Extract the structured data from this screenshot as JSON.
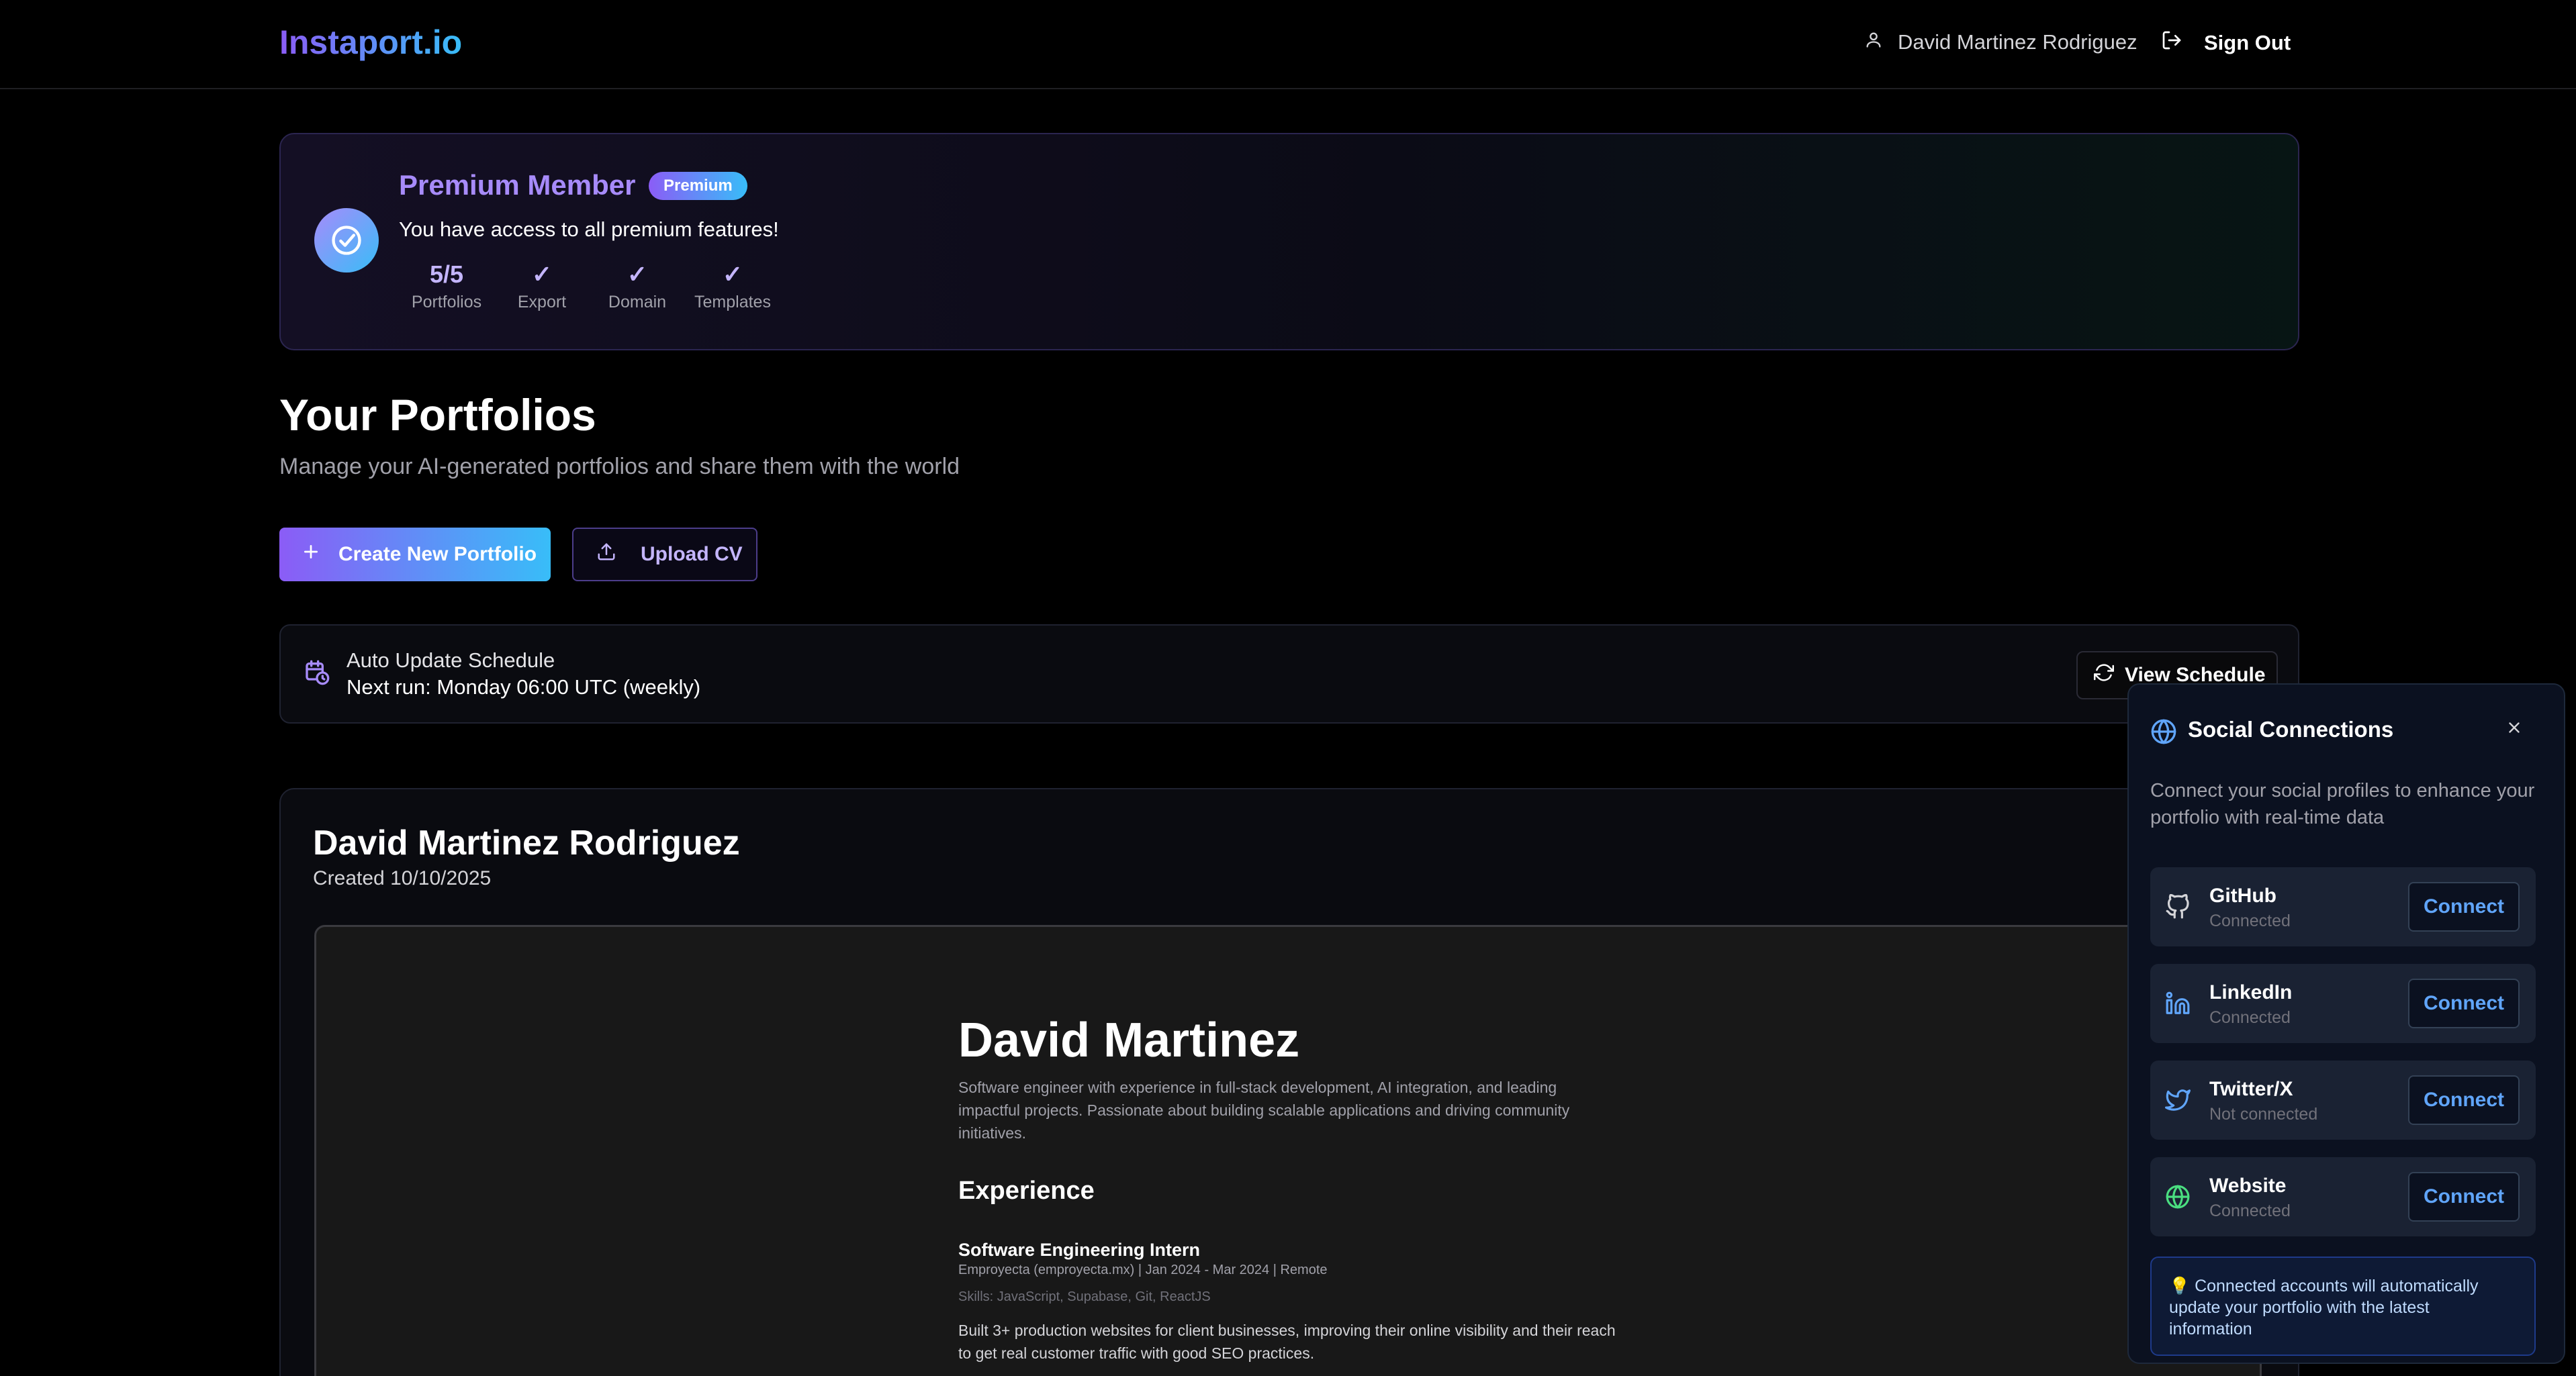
{
  "header": {
    "logo": "Instaport.io",
    "user_name": "David Martinez Rodriguez",
    "sign_out": "Sign Out"
  },
  "premium": {
    "title": "Premium Member",
    "badge": "Premium",
    "subtitle": "You have access to all premium features!",
    "stats": [
      {
        "value": "5/5",
        "label": "Portfolios"
      },
      {
        "value": "✓",
        "label": "Export"
      },
      {
        "value": "✓",
        "label": "Domain"
      },
      {
        "value": "✓",
        "label": "Templates"
      }
    ]
  },
  "portfolios": {
    "title": "Your Portfolios",
    "subtitle": "Manage your AI-generated portfolios and share them with the world",
    "create_label": "Create New Portfolio",
    "upload_label": "Upload CV"
  },
  "schedule": {
    "title": "Auto Update Schedule",
    "next_run": "Next run: Monday 06:00 UTC (weekly)",
    "view_label": "View Schedule"
  },
  "portfolio_card": {
    "name": "David Martinez Rodriguez",
    "created": "Created 10/10/2025",
    "preview": {
      "name": "David Martinez",
      "bio": "Software engineer with experience in full-stack development, AI integration, and leading impactful projects. Passionate about building scalable applications and driving community initiatives.",
      "section": "Experience",
      "role": "Software Engineering Intern",
      "company_line": "Emproyecta (emproyecta.mx) | Jan 2024 - Mar 2024 | Remote",
      "skills": "Skills: JavaScript, Supabase, Git, ReactJS",
      "description": "Built 3+ production websites for client businesses, improving their online visibility and their reach to get real customer traffic with good SEO practices."
    }
  },
  "social": {
    "title": "Social Connections",
    "description": "Connect your social profiles to enhance your portfolio with real-time data",
    "items": [
      {
        "name": "GitHub",
        "status": "Connected",
        "button": "Connect",
        "icon": "github-icon",
        "color": "#d4d4d8"
      },
      {
        "name": "LinkedIn",
        "status": "Connected",
        "button": "Connect",
        "icon": "linkedin-icon",
        "color": "#60a5fa"
      },
      {
        "name": "Twitter/X",
        "status": "Not connected",
        "button": "Connect",
        "icon": "twitter-icon",
        "color": "#60a5fa"
      },
      {
        "name": "Website",
        "status": "Connected",
        "button": "Connect",
        "icon": "globe-icon",
        "color": "#4ade80"
      }
    ],
    "note": "💡 Connected accounts will automatically update your portfolio with the latest information"
  },
  "colors": {
    "accent_purple": "#8b5cf6",
    "accent_blue": "#38bdf8",
    "link_blue": "#60a5fa"
  }
}
